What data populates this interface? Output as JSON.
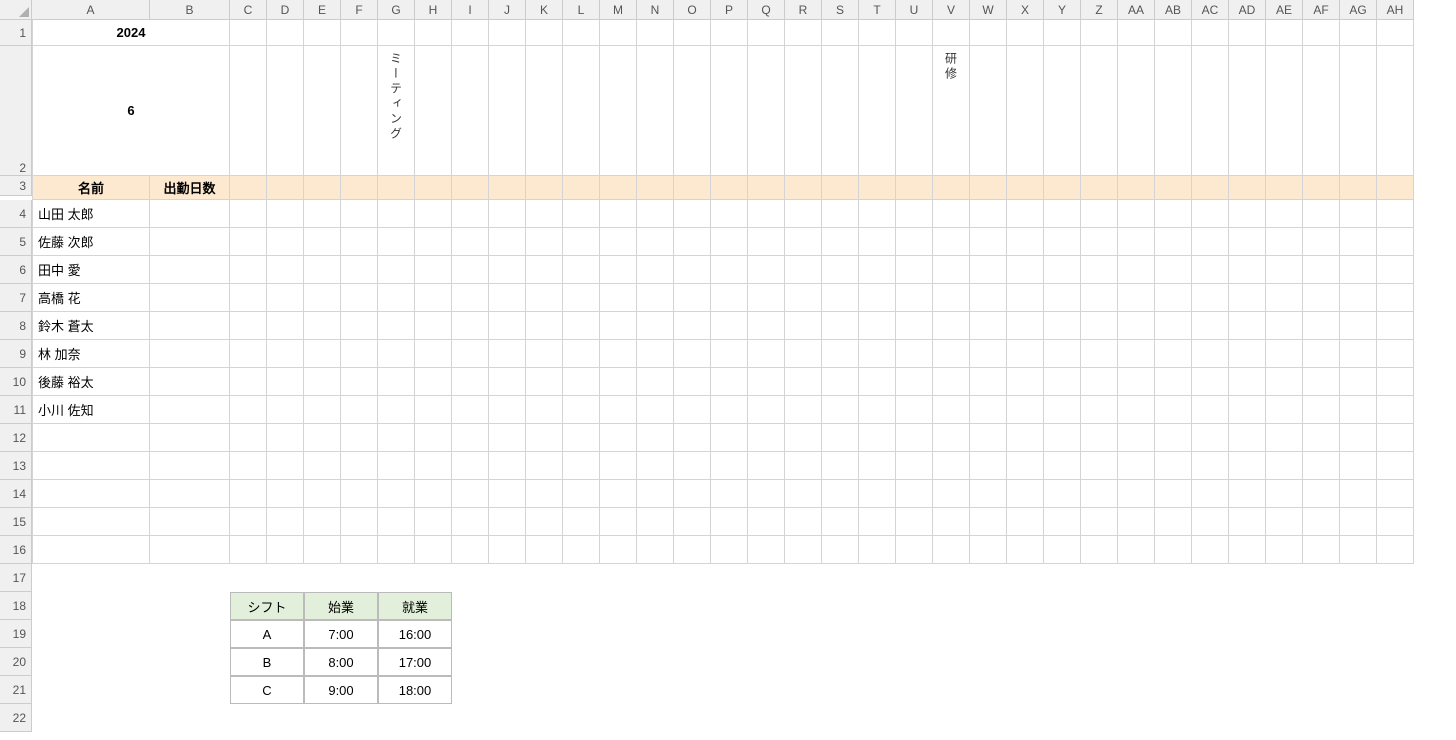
{
  "year": "2024",
  "month": "6",
  "col_letters": [
    "A",
    "B",
    "C",
    "D",
    "E",
    "F",
    "G",
    "H",
    "I",
    "J",
    "K",
    "L",
    "M",
    "N",
    "O",
    "P",
    "Q",
    "R",
    "S",
    "T",
    "U",
    "V",
    "W",
    "X",
    "Y",
    "Z",
    "AA",
    "AB",
    "AC",
    "AD",
    "AE",
    "AF",
    "AG",
    "AH"
  ],
  "row_nums": [
    "1",
    "2",
    "3",
    "4",
    "5",
    "6",
    "7",
    "8",
    "9",
    "10",
    "11",
    "12",
    "13",
    "14",
    "15",
    "16",
    "17",
    "18",
    "19",
    "20",
    "21",
    "22"
  ],
  "row2_notes": {
    "G": "ミーティング",
    "V": "研修"
  },
  "row3": {
    "name": "名前",
    "days": "出勤日数"
  },
  "employees": [
    "山田 太郎",
    "佐藤 次郎",
    "田中 愛",
    "高橋 花",
    "鈴木 蒼太",
    "林 加奈",
    "後藤 裕太",
    "小川 佐知"
  ],
  "shift_table": {
    "headers": [
      "シフト",
      "始業",
      "就業"
    ],
    "rows": [
      [
        "A",
        "7:00",
        "16:00"
      ],
      [
        "B",
        "8:00",
        "17:00"
      ],
      [
        "C",
        "9:00",
        "18:00"
      ]
    ]
  }
}
